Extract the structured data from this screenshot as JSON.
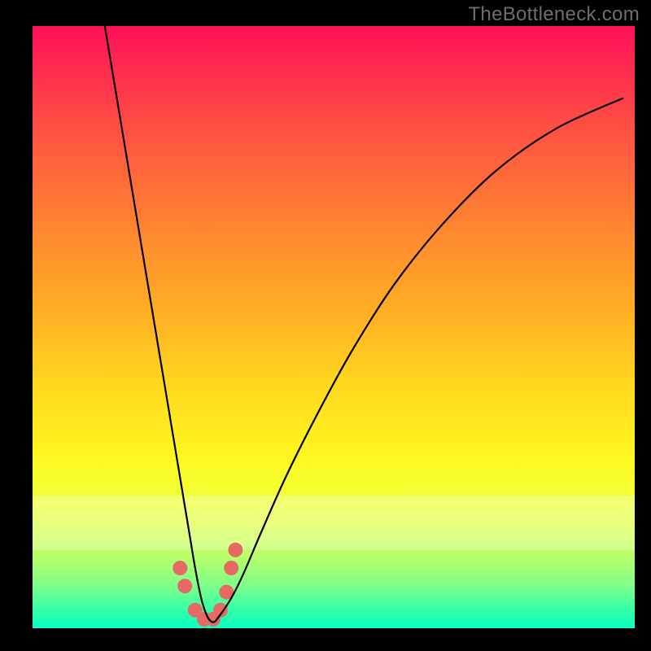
{
  "watermark": "TheBottleneck.com",
  "chart_data": {
    "type": "line",
    "title": "",
    "xlabel": "",
    "ylabel": "",
    "xlim": [
      0,
      100
    ],
    "ylim": [
      0,
      100
    ],
    "series": [
      {
        "name": "bottleneck-curve",
        "x": [
          12,
          14,
          16,
          18,
          20,
          22,
          24,
          26,
          27,
          28,
          29,
          30,
          31,
          33,
          35,
          38,
          42,
          47,
          53,
          60,
          68,
          77,
          87,
          98
        ],
        "values": [
          100,
          88,
          76,
          64,
          52,
          40,
          28,
          16,
          10,
          5,
          2,
          1,
          2,
          5,
          9,
          16,
          25,
          35,
          46,
          57,
          67,
          76,
          83,
          88
        ]
      }
    ],
    "markers": {
      "name": "highlight-dots",
      "color": "#e46a63",
      "points": [
        {
          "x": 24.5,
          "y": 10
        },
        {
          "x": 25.3,
          "y": 7
        },
        {
          "x": 27.0,
          "y": 3
        },
        {
          "x": 28.5,
          "y": 1.5
        },
        {
          "x": 30.0,
          "y": 1.5
        },
        {
          "x": 31.2,
          "y": 3
        },
        {
          "x": 32.2,
          "y": 6
        },
        {
          "x": 33.0,
          "y": 10
        },
        {
          "x": 33.7,
          "y": 13
        }
      ]
    },
    "gradient_stops": [
      {
        "pos": 0.0,
        "color": "#ff1158"
      },
      {
        "pos": 0.35,
        "color": "#ff8a2f"
      },
      {
        "pos": 0.7,
        "color": "#fff31f"
      },
      {
        "pos": 1.0,
        "color": "#0affc6"
      }
    ]
  }
}
